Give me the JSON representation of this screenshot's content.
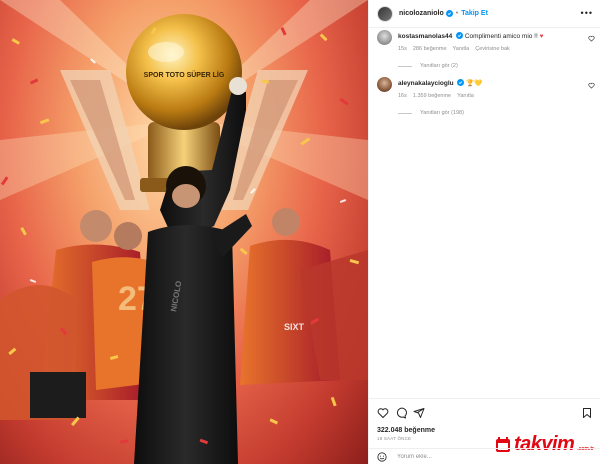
{
  "post": {
    "author": "nicolozaniolo",
    "follow_label": "Takip Et",
    "separator": "•",
    "more_label": "•••"
  },
  "comments": [
    {
      "username": "kostasmanolas44",
      "text": "Complimenti amico mio !! ",
      "emoji": "♥",
      "time": "15s",
      "likes": "286 beğenme",
      "reply_label": "Yanıtla",
      "translate_label": "Çevirisine bak",
      "view_replies": "Yanıtları gör (2)"
    },
    {
      "username": "aleynakalaycioglu",
      "text": " ",
      "emoji": "🏆💛",
      "time": "16s",
      "likes": "1.359 beğenme",
      "reply_label": "Yanıtla",
      "view_replies": "Yanıtları gör (198)"
    }
  ],
  "footer": {
    "likes": "322.048 beğenme",
    "time": "18 SAAT ÖNCE",
    "comment_placeholder": "Yorum ekle..."
  },
  "image": {
    "trophy_text": "SPOR TOTO SÜPER LİG",
    "jersey_number": "27",
    "jersey_name": "NICOLO",
    "sponsor_text": "SIXT"
  },
  "watermark": {
    "brand": "takvim",
    "suffix": ".com.tr"
  },
  "colors": {
    "accent_blue": "#0095f6",
    "heart_red": "#ed4956",
    "galatasaray_orange": "#e8742b",
    "galatasaray_red": "#a3172a"
  }
}
